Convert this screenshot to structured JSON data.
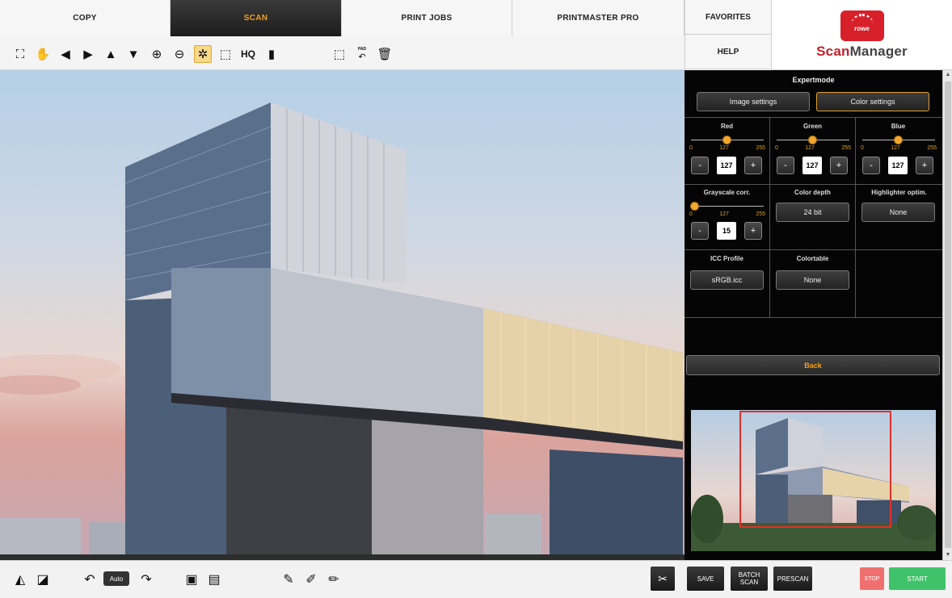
{
  "tabs": [
    {
      "label": "COPY"
    },
    {
      "label": "SCAN"
    },
    {
      "label": "PRINT JOBS"
    },
    {
      "label": "PRINTMASTER PRO"
    }
  ],
  "side_tabs": {
    "favorites": "FAVORITES",
    "help": "HELP"
  },
  "logo": {
    "badge": "rowe",
    "brand_a": "Scan",
    "brand_b": "Manager"
  },
  "toolbar": {
    "icons": [
      "fit-page-icon",
      "hand-pan-icon",
      "move-left-icon",
      "move-right-icon",
      "move-up-icon",
      "move-down-icon",
      "zoom-in-icon",
      "zoom-out-icon",
      "auto-zoom-icon",
      "select-area-icon",
      "hq-label",
      "document-icon",
      "crop-area-icon",
      "undo-icon",
      "delete-icon"
    ],
    "hq": "HQ",
    "pad_label": "PAD"
  },
  "panel": {
    "title": "Expertmode",
    "image_settings": "Image settings",
    "color_settings": "Color settings",
    "channels": [
      {
        "label": "Red",
        "value": "127",
        "min": "0",
        "mid": "127",
        "max": "255",
        "level": 0.5
      },
      {
        "label": "Green",
        "value": "127",
        "min": "0",
        "mid": "127",
        "max": "255",
        "level": 0.5
      },
      {
        "label": "Blue",
        "value": "127",
        "min": "0",
        "mid": "127",
        "max": "255",
        "level": 0.5
      }
    ],
    "grayscale": {
      "label": "Grayscale corr.",
      "value": "15",
      "min": "0",
      "mid": "127",
      "max": "255",
      "level": 0.06
    },
    "color_depth": {
      "label": "Color depth",
      "value": "24 bit"
    },
    "highlighter": {
      "label": "Highlighter optim.",
      "value": "None"
    },
    "icc": {
      "label": "ICC Profile",
      "value": "sRGB.icc"
    },
    "colortable": {
      "label": "Colortable",
      "value": "None"
    },
    "back": "Back",
    "minus": "-",
    "plus": "+"
  },
  "bottom": {
    "auto": "Auto",
    "save": "SAVE",
    "batch_scan_1": "BATCH",
    "batch_scan_2": "SCAN",
    "prescan": "PRESCAN",
    "stop": "STOP",
    "start": "START"
  },
  "colors": {
    "accent": "#f0a020",
    "stop": "#f07070",
    "start": "#3fc36a",
    "brand": "#c81e28"
  }
}
